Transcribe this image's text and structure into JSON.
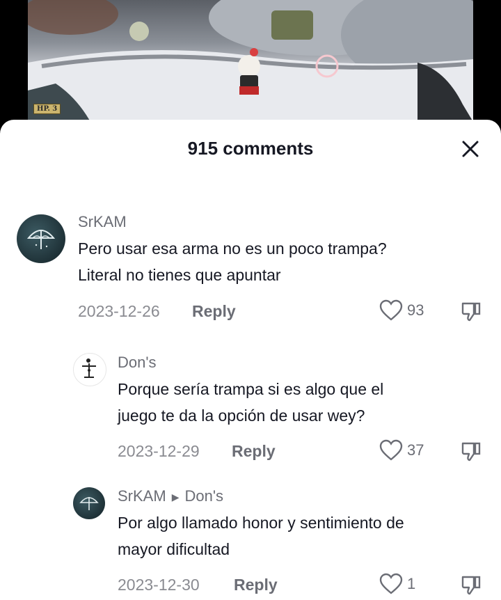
{
  "video": {
    "hp_badge": "HP. 3"
  },
  "sheet": {
    "title": "915 comments"
  },
  "comments": [
    {
      "username": "SrKAM",
      "text_lines": [
        "Pero usar esa arma no es un poco trampa?",
        "Literal no tienes que apuntar"
      ],
      "date": "2023-12-26",
      "reply_label": "Reply",
      "likes": "93"
    },
    {
      "username": "Don's",
      "text_lines": [
        "Porque sería trampa si es algo que el",
        "juego te da la opción de usar wey?"
      ],
      "date": "2023-12-29",
      "reply_label": "Reply",
      "likes": "37"
    },
    {
      "username": "SrKAM",
      "reply_to": "Don's",
      "text_lines": [
        "Por algo llamado honor y sentimiento de",
        "mayor dificultad"
      ],
      "date": "2023-12-30",
      "reply_label": "Reply",
      "likes": "1"
    }
  ],
  "icons": {
    "close": "close-icon",
    "like": "heart-icon",
    "dislike": "thumbs-down-icon",
    "avatar_a": "umbrella-logo",
    "avatar_b": "stick-figure"
  },
  "colors": {
    "text": "#161823",
    "muted": "#6b6d75",
    "background": "#ffffff"
  }
}
